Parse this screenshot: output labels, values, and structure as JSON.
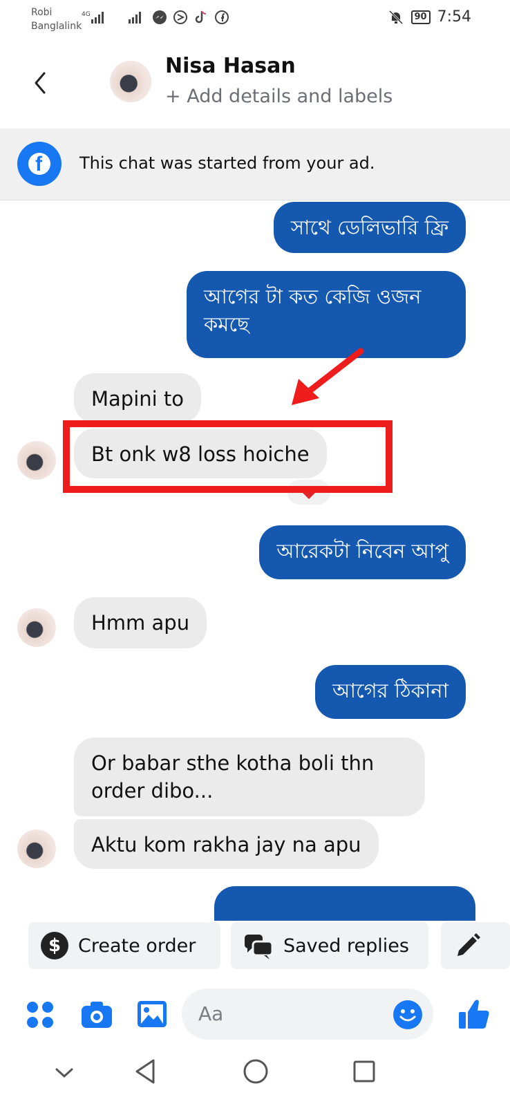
{
  "status_bar": {
    "carrier_line1": "Robi",
    "carrier_line2": "Banglalink",
    "network": "4G",
    "battery": "90",
    "time": "7:54"
  },
  "header": {
    "contact_name": "Nisa Hasan",
    "add_details": "+ Add details and labels"
  },
  "banner": {
    "text": "This chat was started from your ad."
  },
  "messages": [
    {
      "dir": "out",
      "text": "সাথে ডেলিভারি ফ্রি"
    },
    {
      "dir": "out",
      "text": "আগের টা কত কেজি ওজন কমছে"
    },
    {
      "dir": "in",
      "text": "Mapini to"
    },
    {
      "dir": "in",
      "text": "Bt onk w8 loss hoiche"
    },
    {
      "dir": "out",
      "text": "আরেকটা নিবেন আপু"
    },
    {
      "dir": "in",
      "text": "Hmm apu"
    },
    {
      "dir": "out",
      "text": "আগের ঠিকানা"
    },
    {
      "dir": "in",
      "text": "Or babar sthe kotha boli thn order dibo..."
    },
    {
      "dir": "in",
      "text": "Aktu kom rakha jay na apu"
    }
  ],
  "reaction": "heart",
  "quick_actions": {
    "create_order": "Create order",
    "saved_replies": "Saved replies"
  },
  "composer": {
    "placeholder": "Aa"
  },
  "colors": {
    "outgoing_bubble": "#1558b0",
    "incoming_bubble": "#ebebeb",
    "accent": "#1877f2",
    "highlight": "#ee1c1c"
  },
  "icons": [
    "back-icon",
    "facebook-icon",
    "dollar-icon",
    "saved-replies-icon",
    "edit-icon",
    "menu-dots-icon",
    "camera-icon",
    "gallery-icon",
    "emoji-icon",
    "like-icon",
    "nav-down-icon",
    "nav-back-icon",
    "nav-home-icon",
    "nav-recents-icon"
  ]
}
